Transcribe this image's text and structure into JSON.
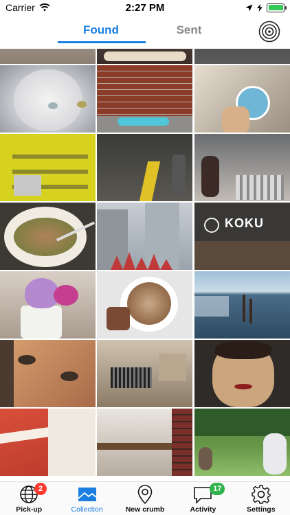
{
  "status_bar": {
    "carrier": "Carrier",
    "time": "2:27 PM"
  },
  "header": {
    "tabs": [
      {
        "label": "Found",
        "active": true
      },
      {
        "label": "Sent",
        "active": false
      }
    ],
    "accent_color": "#1a7fe0"
  },
  "photos": [
    {
      "subject": "white persian cat"
    },
    {
      "subject": "brick wall with blue shoe"
    },
    {
      "subject": "hand holding sticker"
    },
    {
      "subject": "bakery shelves in yellow"
    },
    {
      "subject": "subway platform"
    },
    {
      "subject": "market crowd"
    },
    {
      "subject": "bowl of pho with chopsticks"
    },
    {
      "subject": "city skyline with red sculpture"
    },
    {
      "subject": "KOKU ramen storefront",
      "sign_text": "KOKU"
    },
    {
      "subject": "purple soft serve with flower"
    },
    {
      "subject": "latte and brownie"
    },
    {
      "subject": "river with pier posts"
    },
    {
      "subject": "portrait painting eyes"
    },
    {
      "subject": "wooden desk scene"
    },
    {
      "subject": "cookie face dessert"
    },
    {
      "subject": "highlighter and paper"
    },
    {
      "subject": "library reading room"
    },
    {
      "subject": "people in park under tree"
    }
  ],
  "tabbar": {
    "items": [
      {
        "label": "Pick-up",
        "icon": "globe-icon",
        "badge": "2",
        "active": false
      },
      {
        "label": "Collection",
        "icon": "image-icon",
        "badge": "",
        "active": true
      },
      {
        "label": "New crumb",
        "icon": "map-pin-icon",
        "badge": "",
        "active": false
      },
      {
        "label": "Activity",
        "icon": "chat-bubble-icon",
        "badge": "17",
        "active": false
      },
      {
        "label": "Settings",
        "icon": "gear-icon",
        "badge": "",
        "active": false
      }
    ]
  }
}
